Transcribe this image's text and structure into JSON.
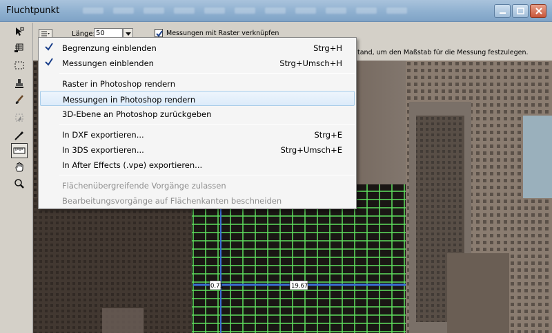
{
  "window": {
    "title": "Fluchtpunkt"
  },
  "options": {
    "length_label": "Länge:",
    "length_value": "50",
    "grid_checkbox_label": "Messungen mit Raster verknüpfen",
    "grid_checkbox_checked": true,
    "hint": "tand, um den Maßstab für die Messung festzulegen."
  },
  "menu": {
    "items": [
      {
        "label": "Begrenzung einblenden",
        "shortcut": "Strg+H",
        "checked": true
      },
      {
        "label": "Messungen einblenden",
        "shortcut": "Strg+Umsch+H",
        "checked": true
      },
      {
        "label": "Raster in Photoshop rendern",
        "shortcut": ""
      },
      {
        "label": "Messungen in Photoshop rendern",
        "shortcut": "",
        "highlighted": true
      },
      {
        "label": "3D-Ebene an Photoshop zurückgeben",
        "shortcut": ""
      },
      {
        "label": "In DXF exportieren...",
        "shortcut": "Strg+E"
      },
      {
        "label": "In 3DS exportieren...",
        "shortcut": "Strg+Umsch+E"
      },
      {
        "label": "In After Effects (.vpe) exportieren...",
        "shortcut": ""
      },
      {
        "label": "Flächenübergreifende Vorgänge zulassen",
        "shortcut": "",
        "disabled": true
      },
      {
        "label": "Bearbeitungsvorgänge auf Flächenkanten beschneiden",
        "shortcut": "",
        "disabled": true
      }
    ]
  },
  "canvas": {
    "measure_small": "0.71",
    "measure_large": "19.67"
  },
  "colors": {
    "grid_green": "#5fe05f",
    "measure_blue": "#3a6fd8",
    "highlight": "#dcebfa"
  },
  "icons": [
    "edit-plane-icon",
    "create-plane-icon",
    "marquee-icon",
    "stamp-icon",
    "brush-icon",
    "transform-icon",
    "eyedropper-icon",
    "measure-icon",
    "hand-icon",
    "zoom-icon"
  ]
}
